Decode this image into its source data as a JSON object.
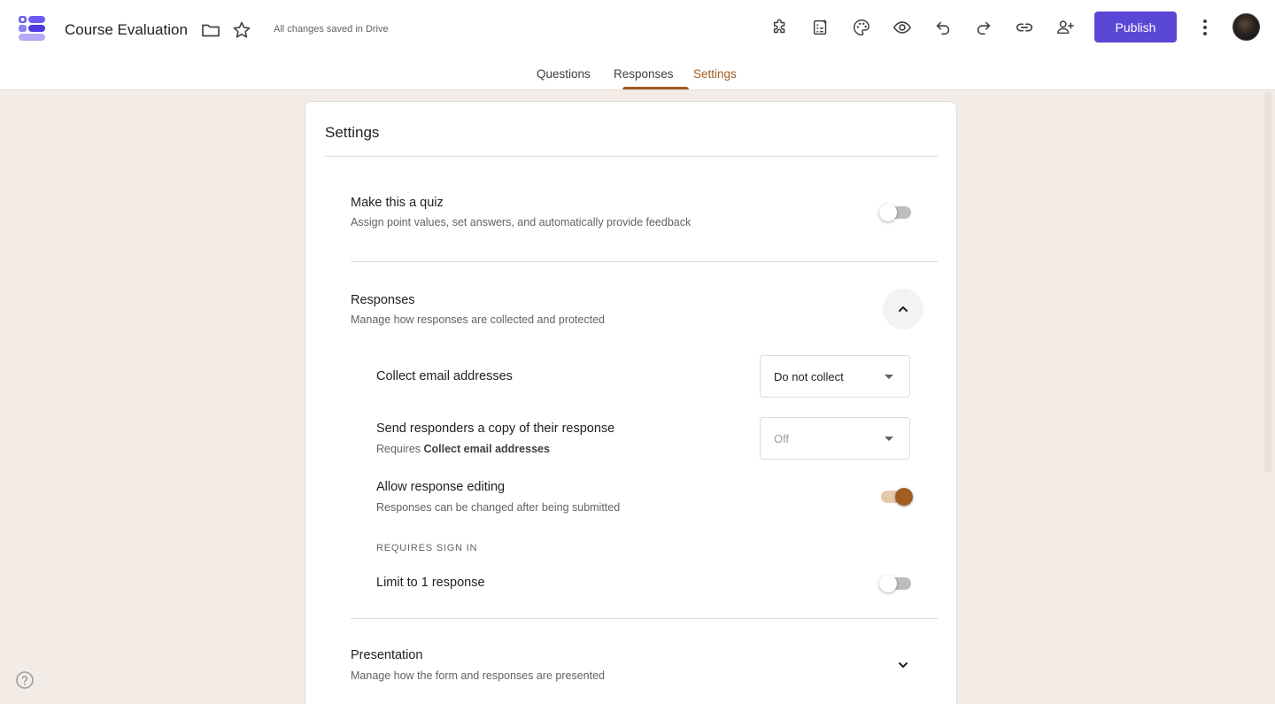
{
  "header": {
    "title": "Course Evaluation",
    "save_status": "All changes saved in Drive",
    "publish_label": "Publish",
    "toolbar_icons": [
      "add-ons-icon",
      "ai-sparkle-form-icon",
      "palette-icon",
      "preview-eye-icon",
      "undo-icon",
      "redo-icon",
      "link-icon",
      "add-collaborator-icon"
    ]
  },
  "tabs": [
    {
      "label": "Questions",
      "active": false
    },
    {
      "label": "Responses",
      "active": false
    },
    {
      "label": "Settings",
      "active": true
    }
  ],
  "settings": {
    "title": "Settings",
    "quiz": {
      "title": "Make this a quiz",
      "subtitle": "Assign point values, set answers, and automatically provide feedback",
      "enabled": false
    },
    "responses": {
      "title": "Responses",
      "subtitle": "Manage how responses are collected and protected",
      "expanded": true,
      "collect_email": {
        "label": "Collect email addresses",
        "value": "Do not collect"
      },
      "send_copy": {
        "label": "Send responders a copy of their response",
        "sub_prefix": "Requires ",
        "sub_bold": "Collect email addresses",
        "value": "Off"
      },
      "allow_editing": {
        "label": "Allow response editing",
        "subtitle": "Responses can be changed after being submitted",
        "enabled": true
      },
      "requires_sign_in_caption": "REQUIRES SIGN IN",
      "limit_one": {
        "label": "Limit to 1 response",
        "enabled": false
      }
    },
    "presentation": {
      "title": "Presentation",
      "subtitle": "Manage how the form and responses are presented",
      "expanded": false
    }
  },
  "colors": {
    "accent": "#a15c1f",
    "publish": "#5b47d6",
    "background": "#f3ebe6"
  }
}
